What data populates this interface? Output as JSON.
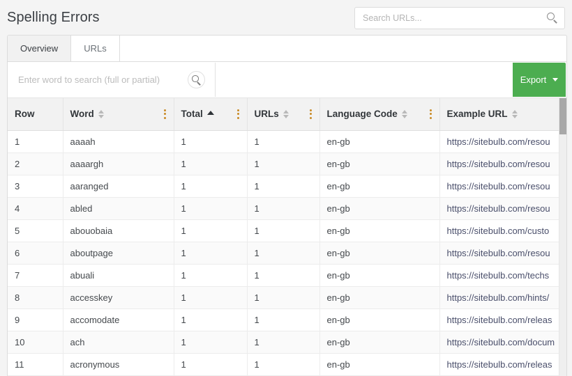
{
  "header": {
    "title": "Spelling Errors",
    "url_search": {
      "placeholder": "Search URLs...",
      "value": "",
      "icon": "search-icon"
    }
  },
  "tabs": [
    {
      "label": "Overview",
      "active": true
    },
    {
      "label": "URLs",
      "active": false
    }
  ],
  "toolbar": {
    "word_search": {
      "placeholder": "Enter word to search (full or partial)",
      "value": "",
      "icon": "search-icon"
    },
    "export_label": "Export",
    "export_caret_icon": "chevron-down-icon",
    "export_color": "#4cad50"
  },
  "table": {
    "columns": [
      {
        "label": "Row",
        "sort": "none",
        "menu": false
      },
      {
        "label": "Word",
        "sort": "both",
        "menu": true
      },
      {
        "label": "Total",
        "sort": "asc",
        "menu": true
      },
      {
        "label": "URLs",
        "sort": "both",
        "menu": true
      },
      {
        "label": "Language Code",
        "sort": "both",
        "menu": true
      },
      {
        "label": "Example URL",
        "sort": "both",
        "menu": false
      }
    ],
    "rows": [
      {
        "row": "1",
        "word": "aaaah",
        "total": "1",
        "urls": "1",
        "language_code": "en-gb",
        "example_url": "https://sitebulb.com/resou"
      },
      {
        "row": "2",
        "word": "aaaargh",
        "total": "1",
        "urls": "1",
        "language_code": "en-gb",
        "example_url": "https://sitebulb.com/resou"
      },
      {
        "row": "3",
        "word": "aaranged",
        "total": "1",
        "urls": "1",
        "language_code": "en-gb",
        "example_url": "https://sitebulb.com/resou"
      },
      {
        "row": "4",
        "word": "abled",
        "total": "1",
        "urls": "1",
        "language_code": "en-gb",
        "example_url": "https://sitebulb.com/resou"
      },
      {
        "row": "5",
        "word": "abouobaia",
        "total": "1",
        "urls": "1",
        "language_code": "en-gb",
        "example_url": "https://sitebulb.com/custo"
      },
      {
        "row": "6",
        "word": "aboutpage",
        "total": "1",
        "urls": "1",
        "language_code": "en-gb",
        "example_url": "https://sitebulb.com/resou"
      },
      {
        "row": "7",
        "word": "abuali",
        "total": "1",
        "urls": "1",
        "language_code": "en-gb",
        "example_url": "https://sitebulb.com/techs"
      },
      {
        "row": "8",
        "word": "accesskey",
        "total": "1",
        "urls": "1",
        "language_code": "en-gb",
        "example_url": "https://sitebulb.com/hints/"
      },
      {
        "row": "9",
        "word": "accomodate",
        "total": "1",
        "urls": "1",
        "language_code": "en-gb",
        "example_url": "https://sitebulb.com/releas"
      },
      {
        "row": "10",
        "word": "ach",
        "total": "1",
        "urls": "1",
        "language_code": "en-gb",
        "example_url": "https://sitebulb.com/docum"
      },
      {
        "row": "11",
        "word": "acronymous",
        "total": "1",
        "urls": "1",
        "language_code": "en-gb",
        "example_url": "https://sitebulb.com/releas"
      }
    ]
  }
}
